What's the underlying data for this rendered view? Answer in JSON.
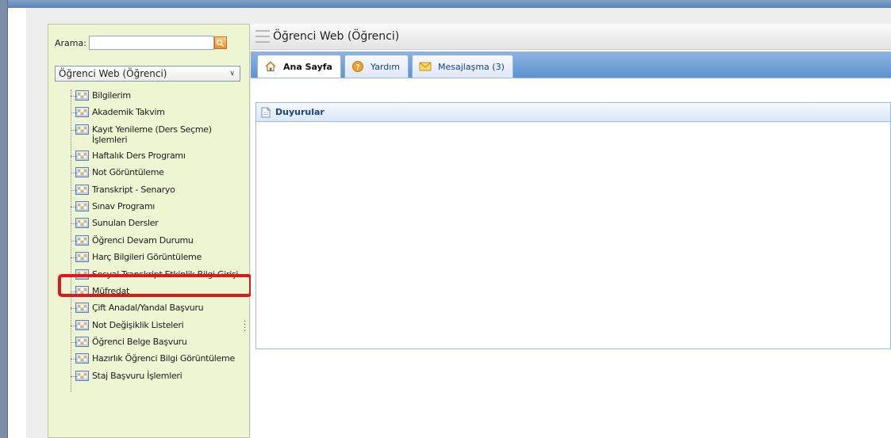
{
  "search": {
    "label": "Arama:",
    "value": ""
  },
  "module_select": {
    "selected": "Öğrenci Web (Öğrenci)"
  },
  "sidebar": {
    "items": [
      {
        "label": "Bilgilerim"
      },
      {
        "label": "Akademik Takvim"
      },
      {
        "label": "Kayıt Yenileme (Ders Seçme) İşlemleri"
      },
      {
        "label": "Haftalık Ders Programı"
      },
      {
        "label": "Not Görüntüleme"
      },
      {
        "label": "Transkript - Senaryo"
      },
      {
        "label": "Sınav Programı"
      },
      {
        "label": "Sunulan Dersler"
      },
      {
        "label": "Öğrenci Devam Durumu"
      },
      {
        "label": "Harç Bilgileri Görüntüleme"
      },
      {
        "label": "Sosyal Transkript Etkinlik Bilgi Girişi",
        "highlighted": true
      },
      {
        "label": "Müfredat"
      },
      {
        "label": "Çift Anadal/Yandal Başvuru"
      },
      {
        "label": "Not Değişiklik Listeleri"
      },
      {
        "label": "Öğrenci Belge Başvuru"
      },
      {
        "label": "Hazırlık Öğrenci Bilgi Görüntüleme"
      },
      {
        "label": "Staj Başvuru İşlemleri"
      }
    ]
  },
  "header": {
    "title": "Öğrenci Web (Öğrenci)"
  },
  "tabs": [
    {
      "label": "Ana Sayfa",
      "icon": "home-icon",
      "active": true
    },
    {
      "label": "Yardım",
      "icon": "help-icon",
      "active": false
    },
    {
      "label": "Mesajlaşma (3)",
      "icon": "envelope-icon",
      "active": false
    }
  ],
  "panel": {
    "title": "Duyurular",
    "icon": "document-icon"
  },
  "colors": {
    "sidebar_bg": "#eef5d3",
    "tabbar_blue": "#5f93d0",
    "highlight_red": "#e2161b",
    "title_blue": "#15428b"
  }
}
